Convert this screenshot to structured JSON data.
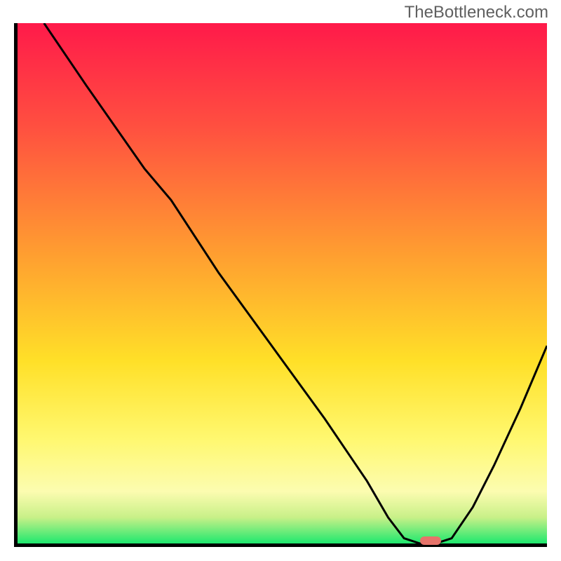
{
  "watermark": "TheBottleneck.com",
  "chart_data": {
    "type": "line",
    "title": "",
    "xlabel": "",
    "ylabel": "",
    "xlim": [
      0,
      100
    ],
    "ylim": [
      0,
      100
    ],
    "gradient_stops": [
      {
        "pos": 0,
        "color": "#ff1a4a"
      },
      {
        "pos": 20,
        "color": "#ff5040"
      },
      {
        "pos": 45,
        "color": "#ffa030"
      },
      {
        "pos": 65,
        "color": "#ffe028"
      },
      {
        "pos": 80,
        "color": "#fff870"
      },
      {
        "pos": 90,
        "color": "#fcfcb0"
      },
      {
        "pos": 95,
        "color": "#c8f088"
      },
      {
        "pos": 100,
        "color": "#1ee86e"
      }
    ],
    "series": [
      {
        "name": "bottleneck-curve",
        "x": [
          5,
          13,
          24,
          29,
          38,
          48,
          58,
          66,
          70,
          73,
          76,
          79,
          82,
          86,
          90,
          95,
          100
        ],
        "y": [
          100,
          88,
          72,
          66,
          52,
          38,
          24,
          12,
          5,
          1,
          0,
          0,
          1,
          7,
          15,
          26,
          38
        ]
      }
    ],
    "minimum_marker": {
      "x": 77.5,
      "y": 0,
      "width": 4,
      "height": 1.6
    }
  }
}
